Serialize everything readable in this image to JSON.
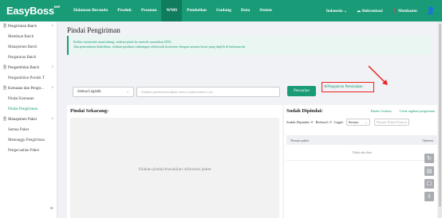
{
  "app": {
    "logo": "EasyBoss",
    "logo_mark": "ERP"
  },
  "nav": [
    "Halaman Beranda",
    "Produk",
    "Pesanan",
    "WMS",
    "Pembelian",
    "Gudang",
    "Data",
    "Sistem"
  ],
  "nav_active": "WMS",
  "topright": {
    "language": "Indonesia",
    "sync": "Sinkronisasi",
    "subscribe": "Membantu"
  },
  "sidebar": {
    "groups": [
      {
        "label": "Pengiriman Batch",
        "items": [
          "Membuat Batch",
          "Manajemen Batch",
          "Pengaturan Batch"
        ]
      },
      {
        "label": "Pengambilan Batch",
        "items": [
          "Pengambilan Produk T"
        ]
      },
      {
        "label": "Kemasan dan Pengir...",
        "items": [
          "Pindai Kemasan",
          "Pindai Pengiriman"
        ]
      },
      {
        "label": "Manajemen Paket",
        "items": [
          "Semua Paket",
          "Menunggu Pengiriman",
          "Pengecualian Paket"
        ]
      }
    ],
    "active_item": "Pindai Pengiriman"
  },
  "main": {
    "title": "Pindai Pengiriman",
    "notice": {
      "line1": "Ketika memindai memindung, silakan pindi ke metode masukkan [EN]",
      "line2": "Jika pemindaian diaktifkan, silakan pastikan timbangan elektronik konsisten dengan sasaran berat yang dipilih di halaman ini"
    },
    "filter": {
      "logistics": "Semua Logistik",
      "search_placeholder": "Silakan pindai/masukkan nomor paket/nomor resi",
      "scan_button": "Pencarian",
      "setting_link": "Pengaturan Pemindaian"
    },
    "left": {
      "title": "Pindai Sekarang:",
      "message": "Silakan pindai/masukkan informasi paket"
    },
    "right": {
      "title": "Sudah Dipindai:",
      "link_print": "Pindai Cetakan",
      "link_log": "Cetak tagihan pengiriman",
      "stats": {
        "scanned_label": "Sudah Dipindai:",
        "scanned": "0",
        "success_label": "Berhasil:",
        "success": "0",
        "fail_label": "Gagal:",
        "filter": "Semua"
      },
      "search_placeholder": "Nomor Paket/Nomor Resi",
      "columns": [
        "Nomor paket",
        "Operasi"
      ],
      "empty": "Tidak ada data"
    }
  }
}
